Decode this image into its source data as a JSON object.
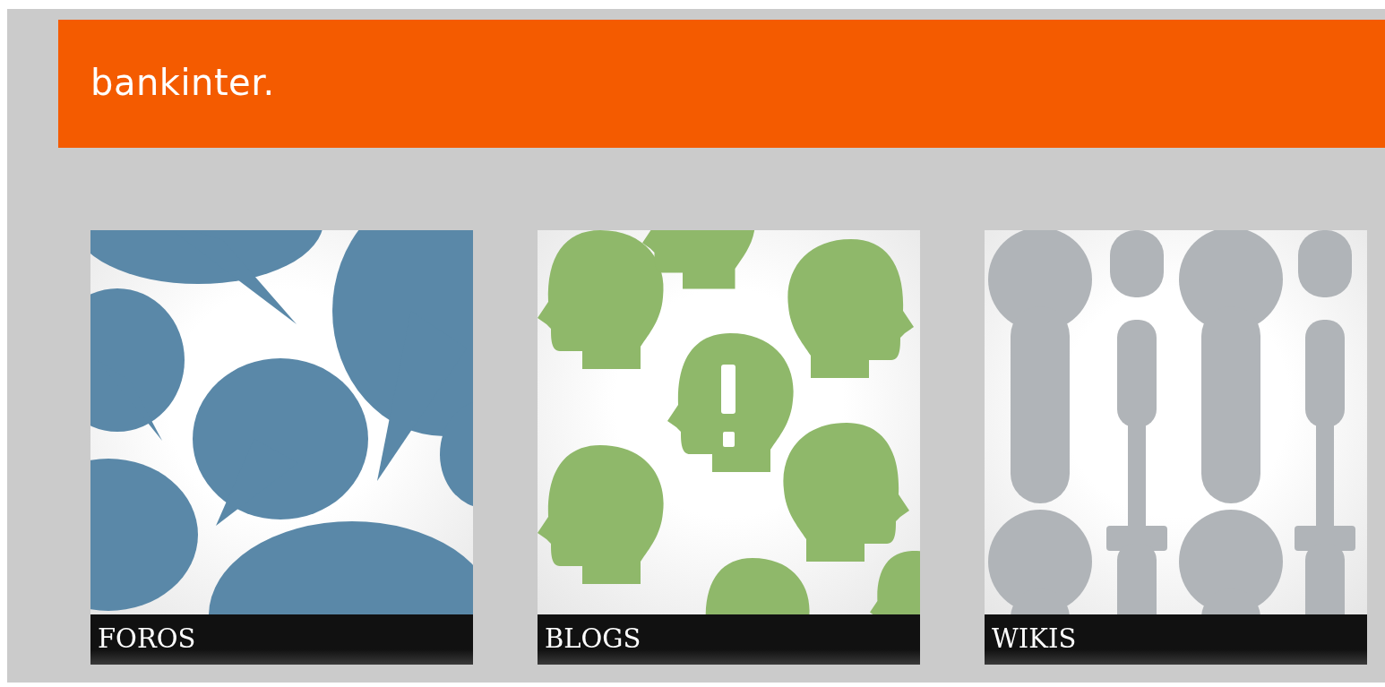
{
  "header": {
    "logo": "bankinter."
  },
  "tiles": [
    {
      "kind": "forums",
      "caption": "FOROS"
    },
    {
      "kind": "blogs",
      "caption": "BLOGS"
    },
    {
      "kind": "wikis",
      "caption": "WIKIS"
    }
  ]
}
